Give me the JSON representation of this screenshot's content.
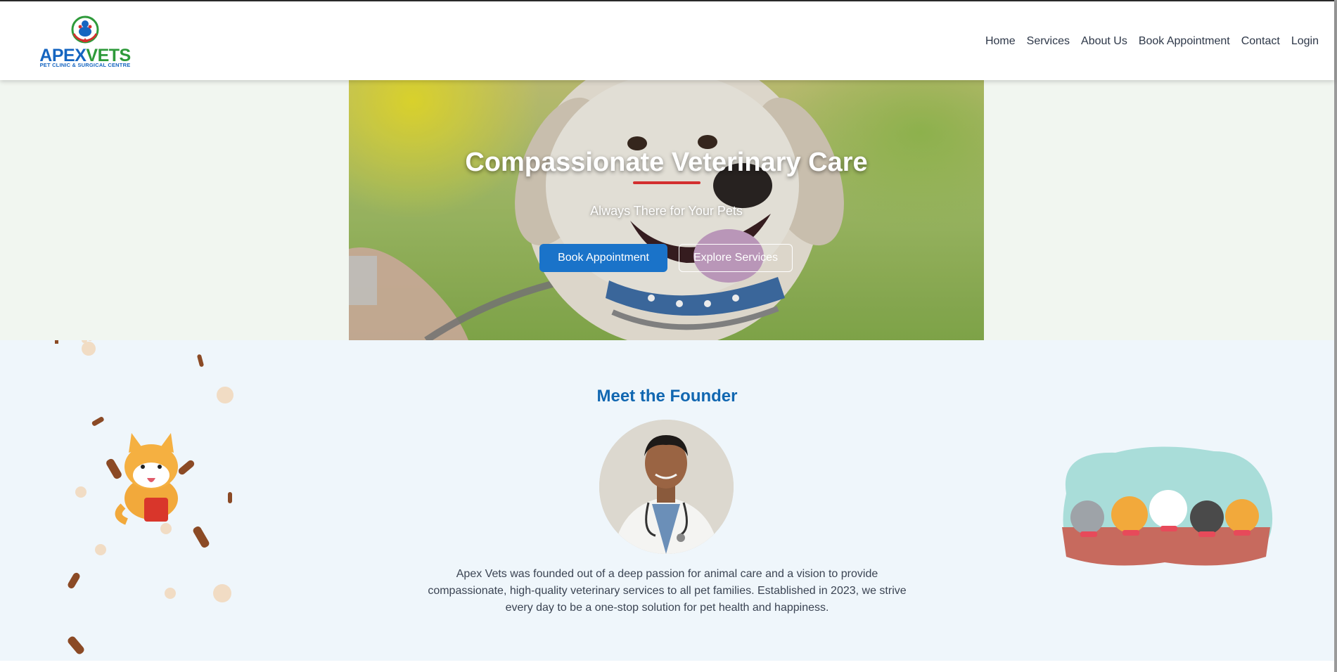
{
  "header": {
    "logo": {
      "name_part1": "APEX",
      "name_part2": "VETS",
      "subtitle": "PET CLINIC & SURGICAL CENTRE"
    },
    "nav": [
      {
        "label": "Home"
      },
      {
        "label": "Services"
      },
      {
        "label": "About Us"
      },
      {
        "label": "Book Appointment"
      },
      {
        "label": "Contact"
      },
      {
        "label": "Login"
      }
    ]
  },
  "hero": {
    "title": "Compassionate Veterinary Care",
    "tagline": "Always There for Your Pets",
    "primary_button": "Book Appointment",
    "secondary_button": "Explore Services"
  },
  "founder": {
    "heading": "Meet the Founder",
    "bio": "Apex Vets was founded out of a deep passion for animal care and a vision to provide compassionate, high-quality veterinary services to all pet families. Established in 2023, we strive every day to be a one-stop solution for pet health and happiness."
  },
  "colors": {
    "brand_blue": "#1565c0",
    "brand_green": "#2e9a3a",
    "accent_red": "#d32f2f",
    "button_blue": "#1a73c9",
    "heading_blue": "#1167b1"
  }
}
